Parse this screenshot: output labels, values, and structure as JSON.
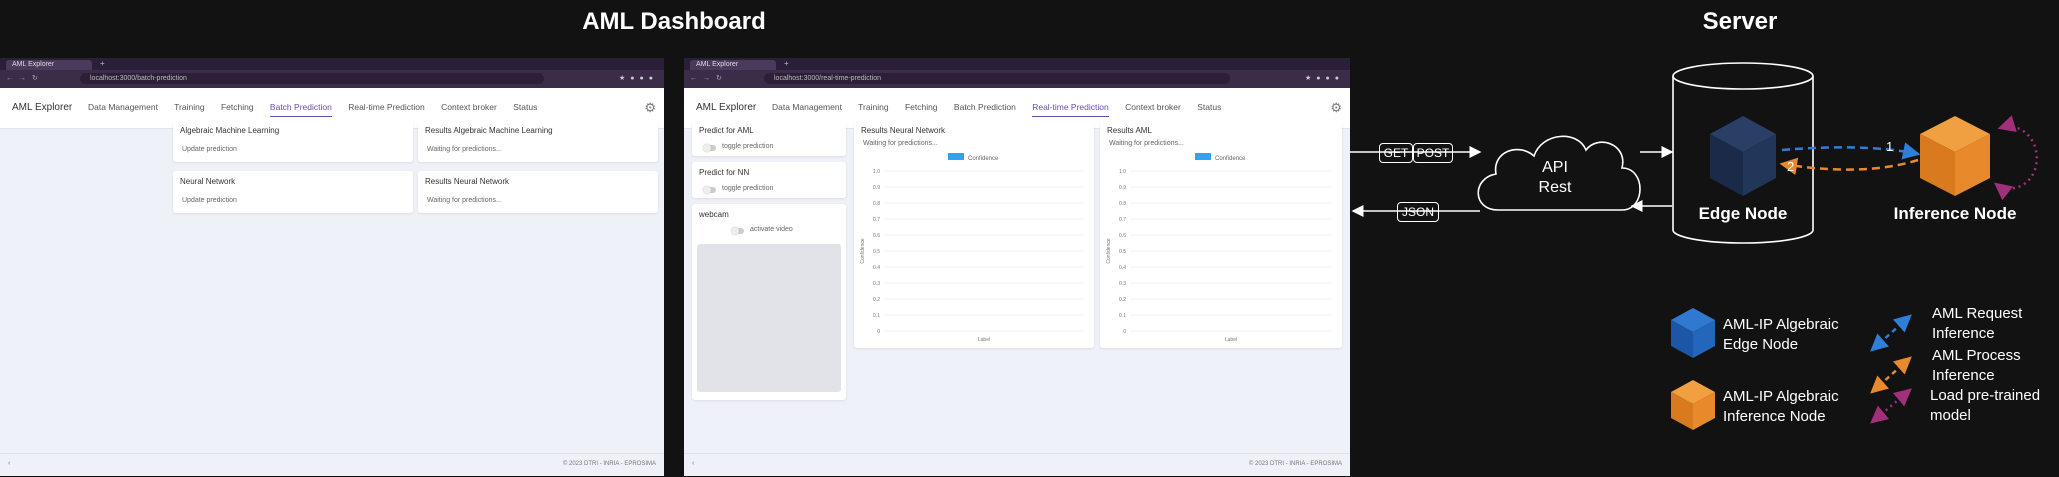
{
  "dashboard_title": "AML Dashboard",
  "server_title": "Server",
  "browser1": {
    "tab_title": "AML Explorer",
    "url": "localhost:3000/batch-prediction",
    "app_name": "AML Explorer",
    "nav": [
      "Data Management",
      "Training",
      "Fetching",
      "Batch Prediction",
      "Real-time Prediction",
      "Context broker",
      "Status"
    ],
    "active_nav": "Batch Prediction",
    "cards": [
      {
        "title": "Algebraic Machine Learning",
        "text": "Update prediction"
      },
      {
        "title": "Results Algebraic Machine Learning",
        "text": "Waiting for predictions..."
      },
      {
        "title": "Neural Network",
        "text": "Update prediction"
      },
      {
        "title": "Results Neural Network",
        "text": "Waiting for predictions..."
      }
    ],
    "footer": "© 2023 DTRI - INRIA - EPROSIMA"
  },
  "browser2": {
    "tab_title": "AML Explorer",
    "url": "localhost:3000/real-time-prediction",
    "app_name": "AML Explorer",
    "nav": [
      "Data Management",
      "Training",
      "Fetching",
      "Batch Prediction",
      "Real-time Prediction",
      "Context broker",
      "Status"
    ],
    "active_nav": "Real-time Prediction",
    "controls": [
      {
        "title": "Predict for AML",
        "toggle": "toggle prediction"
      },
      {
        "title": "Predict for NN",
        "toggle": "toggle prediction"
      },
      {
        "title": "webcam",
        "toggle": "activate video"
      }
    ],
    "results": [
      {
        "title": "Results Neural Network",
        "status": "Waiting for predictions...",
        "legend": "Confidence",
        "ylabel": "Confidence",
        "xlabel": "Label",
        "yticks": [
          "1.0",
          "0.9",
          "0.8",
          "0.7",
          "0.6",
          "0.5",
          "0.4",
          "0.3",
          "0.2",
          "0.1",
          "0"
        ]
      },
      {
        "title": "Results AML",
        "status": "Waiting for predictions...",
        "legend": "Confidence",
        "ylabel": "Confidence",
        "xlabel": "Label",
        "yticks": [
          "1.0",
          "0.9",
          "0.8",
          "0.7",
          "0.6",
          "0.5",
          "0.4",
          "0.3",
          "0.2",
          "0.1",
          "0"
        ]
      }
    ],
    "footer": "© 2023 DTRI - INRIA - EPROSIMA"
  },
  "server": {
    "get_label": "GET",
    "post_label": "POST",
    "json_label": "JSON",
    "api_label_line1": "API",
    "api_label_line2": "Rest",
    "edge_node_label": "Edge Node",
    "inference_node_label": "Inference Node",
    "step1": "1",
    "step2": "2",
    "colors": {
      "edge_blue": "#1f5fb5",
      "inference_orange": "#e8892a",
      "load_purple": "#a0307a",
      "request_blue": "#2f7fd8"
    }
  },
  "legend": {
    "edge_line1": "AML-IP Algebraic",
    "edge_line2": "Edge Node",
    "inference_line1": "AML-IP Algebraic",
    "inference_line2": "Inference Node",
    "request_line1": "AML Request",
    "request_line2": "Inference",
    "process_line1": "AML Process",
    "process_line2": "Inference",
    "load_line1": "Load pre-trained",
    "load_line2": "model"
  }
}
